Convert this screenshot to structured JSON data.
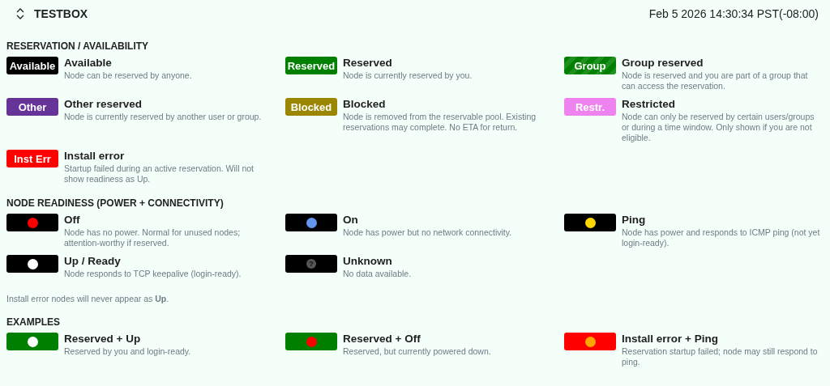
{
  "header": {
    "title": "TESTBOX",
    "timestamp": "Feb 5 2026 14:30:34 PST(-08:00)"
  },
  "sections": [
    {
      "title": "RESERVATION / AVAILABILITY",
      "items": [
        {
          "kind": "label",
          "badge": "Available",
          "color": "#000000",
          "striped": false,
          "title": "Available",
          "description": "Node can be reserved by anyone."
        },
        {
          "kind": "label",
          "badge": "Reserved",
          "color": "#008000",
          "striped": false,
          "title": "Reserved",
          "description": "Node is currently reserved by you."
        },
        {
          "kind": "label",
          "badge": "Group",
          "color": "#008000",
          "striped": true,
          "title": "Group reserved",
          "description": "Node is reserved and you are part of a group that can access the reservation."
        },
        {
          "kind": "label",
          "badge": "Other",
          "color": "#663399",
          "striped": false,
          "title": "Other reserved",
          "description": "Node is currently reserved by another user or group."
        },
        {
          "kind": "label",
          "badge": "Blocked",
          "color": "#9b8600",
          "striped": false,
          "title": "Blocked",
          "description": "Node is removed from the reservable pool. Existing reservations may complete. No ETA for return."
        },
        {
          "kind": "label",
          "badge": "Restr.",
          "color": "#ee82ee",
          "striped": false,
          "title": "Restricted",
          "description": "Node can only be reserved by certain users/groups or during a time window. Only shown if you are not eligible."
        },
        {
          "kind": "label",
          "badge": "Inst Err",
          "color": "#ff0000",
          "striped": false,
          "title": "Install error",
          "description": "Startup failed during an active reservation. Will not show readiness as Up."
        }
      ]
    },
    {
      "title": "NODE READINESS (POWER + CONNECTIVITY)",
      "items": [
        {
          "kind": "dot",
          "color": "#000000",
          "dot": {
            "color": "#ff0000"
          },
          "title": "Off",
          "description": "Node has no power. Normal for unused nodes; attention-worthy if reserved."
        },
        {
          "kind": "dot",
          "color": "#000000",
          "dot": {
            "color": "#6495ed"
          },
          "title": "On",
          "description": "Node has power but no network connectivity."
        },
        {
          "kind": "dot",
          "color": "#000000",
          "dot": {
            "color": "#ffd700"
          },
          "title": "Ping",
          "description": "Node has power and responds to ICMP ping (not yet login-ready)."
        },
        {
          "kind": "dot",
          "color": "#000000",
          "dot": {
            "color": "#ffffff"
          },
          "title": "Up / Ready",
          "description": "Node responds to TCP keepalive (login-ready)."
        },
        {
          "kind": "unknown",
          "color": "#000000",
          "symbol": "?",
          "title": "Unknown",
          "description": "No data available."
        }
      ],
      "note": "Install error nodes will never appear as **Up**."
    },
    {
      "title": "EXAMPLES",
      "items": [
        {
          "kind": "dot",
          "color": "#008000",
          "dot": {
            "color": "#ffffff"
          },
          "title": "Reserved + Up",
          "description": "Reserved by you and login-ready."
        },
        {
          "kind": "dot",
          "color": "#008000",
          "dot": {
            "color": "#ff0000"
          },
          "title": "Reserved + Off",
          "description": "Reserved, but currently powered down."
        },
        {
          "kind": "dot",
          "color": "#ff0000",
          "dot": {
            "color": "#ffa500"
          },
          "title": "Install error + Ping",
          "description": "Reservation startup failed; node may still respond to ping."
        }
      ]
    }
  ]
}
